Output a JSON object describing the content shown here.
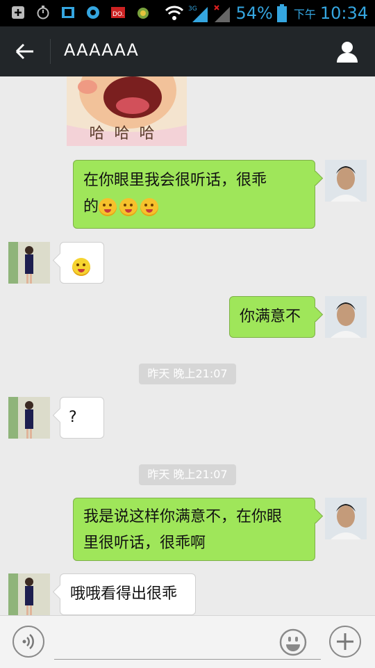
{
  "status_bar": {
    "battery_percent": "54%",
    "time_period": "下午",
    "time": "10:34",
    "network_label": "3G"
  },
  "header": {
    "title": "AAAAAA",
    "back_icon": "arrow-left-icon",
    "profile_icon": "user-icon"
  },
  "sticker": {
    "caption": "哈哈哈"
  },
  "messages": [
    {
      "side": "right",
      "text": "在你眼里我会很听话，很乖",
      "text2": "的",
      "emoji_count": 3
    },
    {
      "side": "left",
      "text": "",
      "emoji_count": 1
    },
    {
      "side": "right",
      "text": "你满意不"
    },
    {
      "type": "timestamp",
      "text": "昨天 晚上21:07"
    },
    {
      "side": "left",
      "text": "?"
    },
    {
      "type": "timestamp",
      "text": "昨天 晚上21:07"
    },
    {
      "side": "right",
      "text": "我是说这样你满意不，在你眼",
      "text2": "里很听话，很乖啊"
    },
    {
      "side": "left",
      "text": "哦哦看得出很乖"
    }
  ],
  "input_bar": {
    "voice_icon": "voice-icon",
    "emoji_icon": "smiley-icon",
    "plus_icon": "plus-icon",
    "input_value": ""
  }
}
